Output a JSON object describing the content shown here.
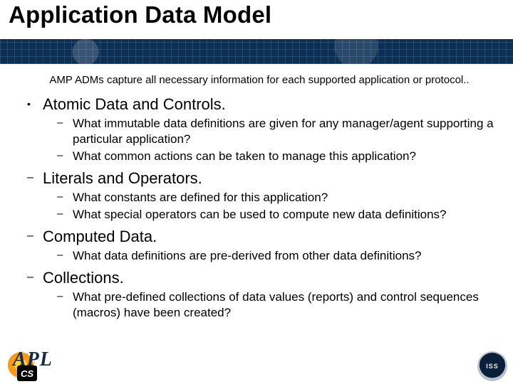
{
  "title": "Application Data Model",
  "intro": "AMP ADMs capture all necessary information for each supported application or protocol..",
  "sections": [
    {
      "bullet": "dot",
      "heading": "Atomic Data and Controls.",
      "items": [
        "What immutable data definitions are given for any manager/agent supporting a particular application?",
        "What common actions can be taken to manage this application?"
      ]
    },
    {
      "bullet": "dash",
      "heading": "Literals and Operators.",
      "items": [
        "What constants are defined for this application?",
        "What special operators can be used to compute new data definitions?"
      ]
    },
    {
      "bullet": "dash",
      "heading": "Computed Data.",
      "items": [
        "What data definitions are pre-derived from other data definitions?"
      ]
    },
    {
      "bullet": "dash",
      "heading": "Collections.",
      "items": [
        "What pre-defined collections of data values (reports) and control sequences (macros) have been created?"
      ]
    }
  ],
  "logos": {
    "left": "CS",
    "center": "APL",
    "right": "ISS"
  }
}
